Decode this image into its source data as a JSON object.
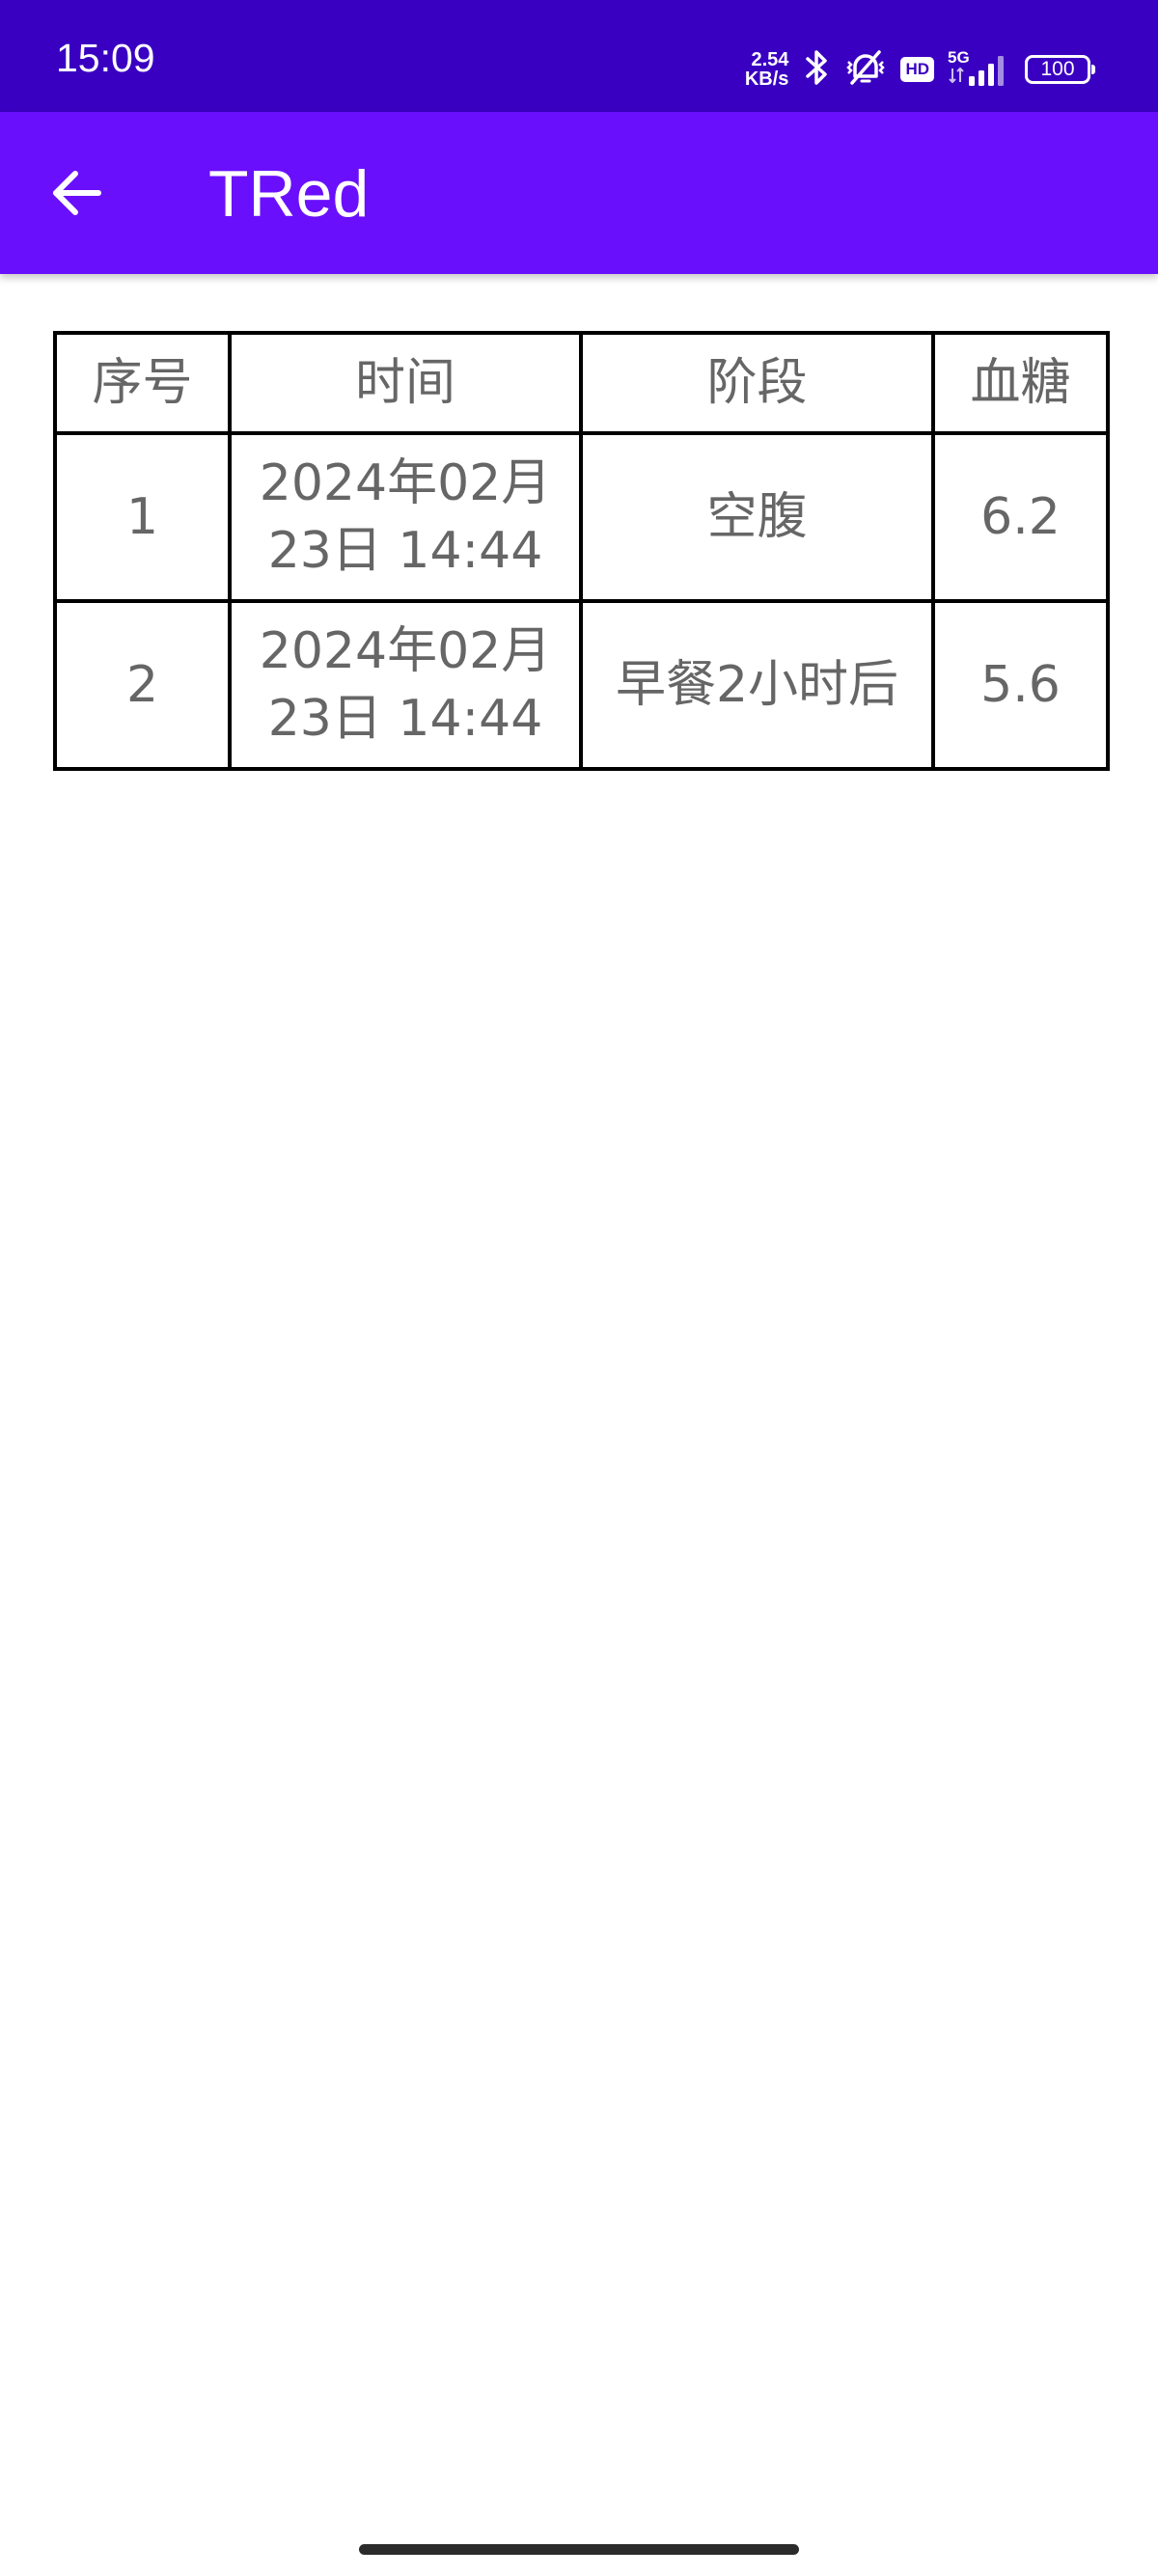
{
  "status_bar": {
    "time": "15:09",
    "net_speed_value": "2.54",
    "net_speed_unit": "KB/s",
    "hd_label": "HD",
    "network_type": "5G",
    "battery_level": "100",
    "icons": [
      "bluetooth-icon",
      "vibrate-mute-icon",
      "signal-icon"
    ]
  },
  "app_bar": {
    "title": "TRed",
    "back_icon": "arrow-left-icon"
  },
  "table": {
    "headers": [
      "序号",
      "时间",
      "阶段",
      "血糖"
    ],
    "rows": [
      {
        "index": "1",
        "time_line1": "2024年02月",
        "time_line2": "23日 14:44",
        "stage": "空腹",
        "glucose": "6.2"
      },
      {
        "index": "2",
        "time_line1": "2024年02月",
        "time_line2": "23日 14:44",
        "stage": "早餐2小时后",
        "glucose": "5.6"
      }
    ]
  },
  "colors": {
    "status_bar_bg": "#3a00c2",
    "app_bar_bg": "#6a0ffc",
    "text_gray": "#666666"
  }
}
